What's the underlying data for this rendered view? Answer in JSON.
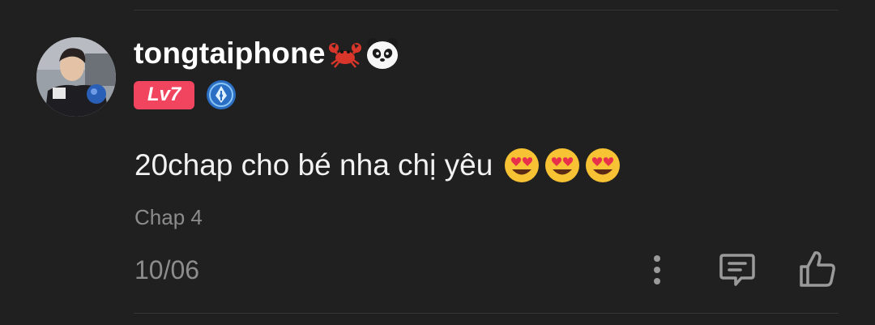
{
  "comment": {
    "username": "tongtaiphone",
    "name_emojis": [
      "crab-icon",
      "panda-icon"
    ],
    "level_badge": "Lv7",
    "rank_icon": "pen-nib-rank-icon",
    "text": "20chap cho bé nha chị yêu",
    "text_emojis": [
      "heart-eyes-emoji",
      "heart-eyes-emoji",
      "heart-eyes-emoji"
    ],
    "chapter": "Chap 4",
    "date": "10/06"
  },
  "actions": {
    "more": "more-vertical-icon",
    "reply": "comment-icon",
    "like": "thumbs-up-icon"
  },
  "colors": {
    "background": "#202020",
    "level_badge": "#f0445f",
    "username": "#ffffff",
    "meta_text": "#8c8c8c"
  }
}
